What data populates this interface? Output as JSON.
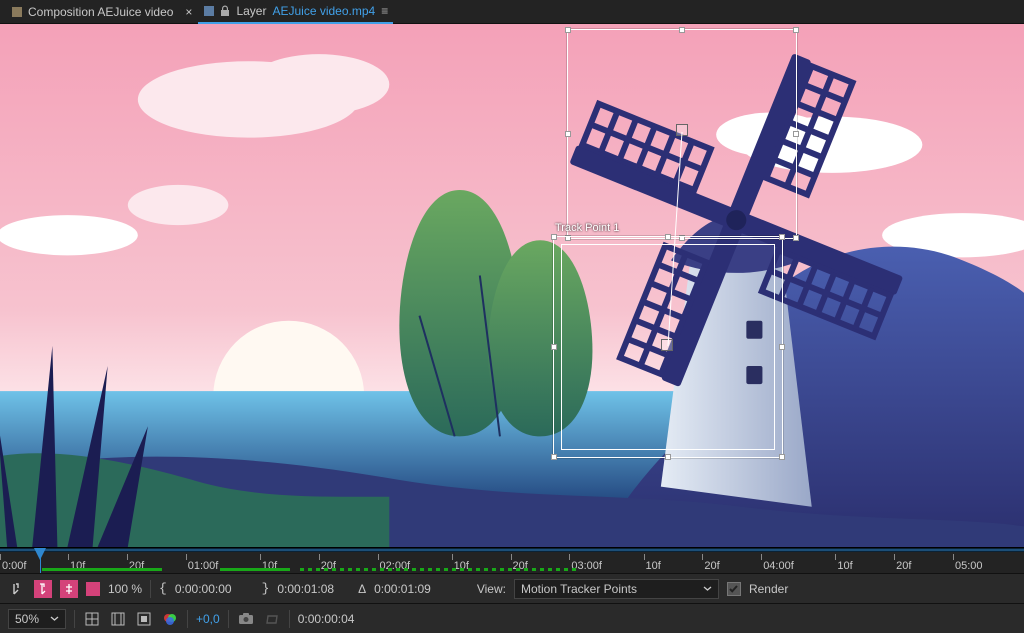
{
  "tabs": {
    "comp": {
      "label": "Composition AEJuice video",
      "swatch": "#8a7a5c"
    },
    "layer": {
      "prefix": "Layer",
      "name": "AEJuice video.mp4",
      "swatch": "#5b7ca3"
    }
  },
  "track": {
    "label": "Track Point 1"
  },
  "ruler": {
    "labels": [
      "0:00f",
      "10f",
      "20f",
      "01:00f",
      "10f",
      "20f",
      "02:00f",
      "10f",
      "20f",
      "03:00f",
      "10f",
      "20f",
      "04:00f",
      "10f",
      "20f",
      "05:00"
    ]
  },
  "bar1": {
    "scale": "100 %",
    "in_time": "0:00:00:00",
    "out_time": "0:00:01:08",
    "delta_label": "Δ",
    "delta_time": "0:00:01:09",
    "view_label": "View:",
    "view_value": "Motion Tracker Points",
    "render": "Render"
  },
  "bar2": {
    "zoom": "50%",
    "offset": "+0,0",
    "current_time": "0:00:00:04"
  },
  "colors": {
    "accent": "#41a0e8",
    "pink": "#d4427a",
    "green": "#18a818"
  }
}
